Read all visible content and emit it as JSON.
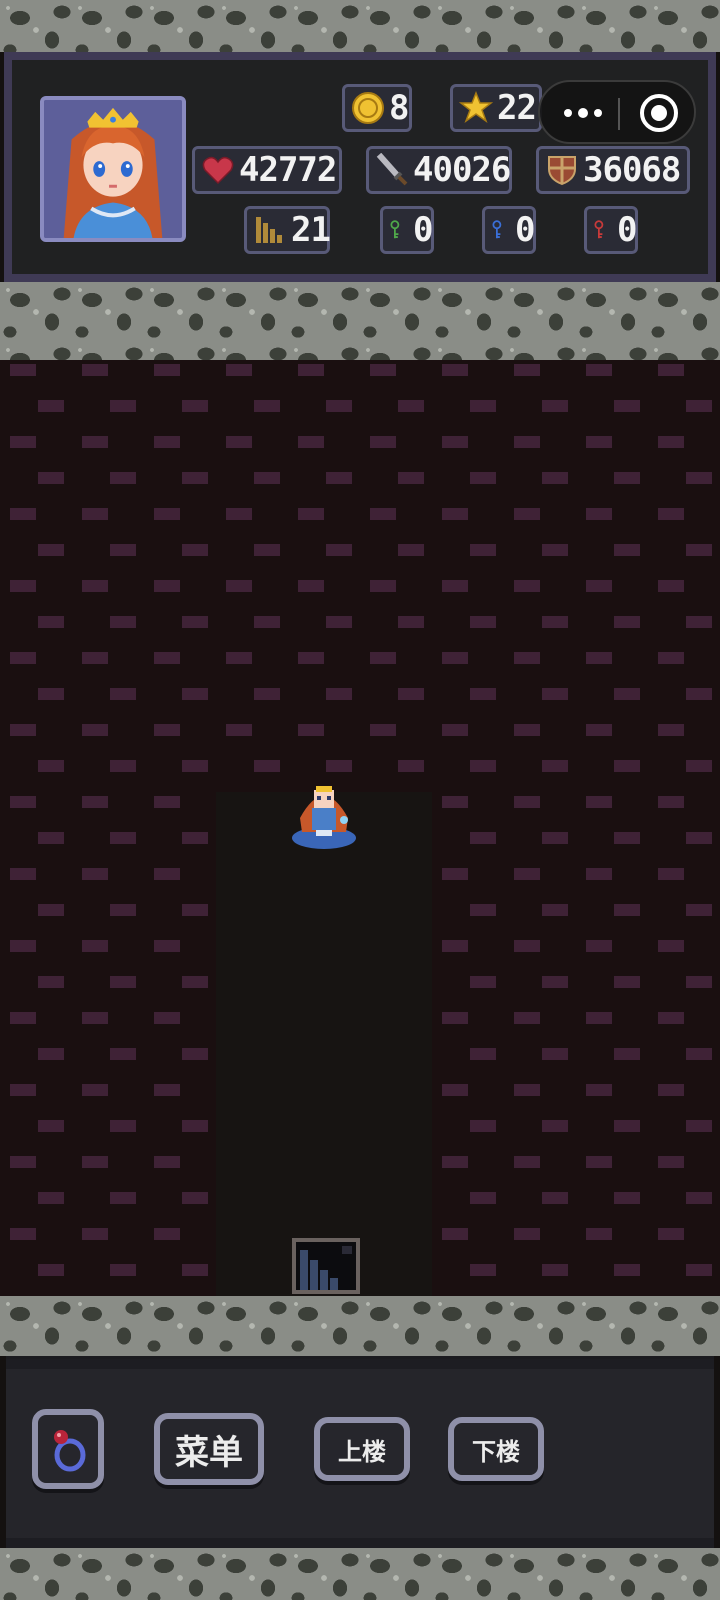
{
  "hud": {
    "gold": "8",
    "stars": "22",
    "hp": "42772",
    "attack": "40026",
    "defense": "36068",
    "floor": "21",
    "green_keys": "0",
    "blue_keys": "0",
    "red_keys": "0"
  },
  "controls": {
    "menu_label": "菜单",
    "up_label": "上楼",
    "down_label": "下楼"
  },
  "icons": {
    "gold": "coin-icon",
    "stars": "star-icon",
    "hp": "heart-icon",
    "attack": "sword-icon",
    "defense": "shield-icon",
    "floor": "stairs-icon",
    "green_key": "green-key-icon",
    "blue_key": "blue-key-icon",
    "red_key": "red-key-icon",
    "ring": "ring-icon"
  },
  "colors": {
    "hud_border": "#3f3a55",
    "chip_border": "#585a78",
    "brick": "#3f2236",
    "floor_dark": "#171412"
  }
}
